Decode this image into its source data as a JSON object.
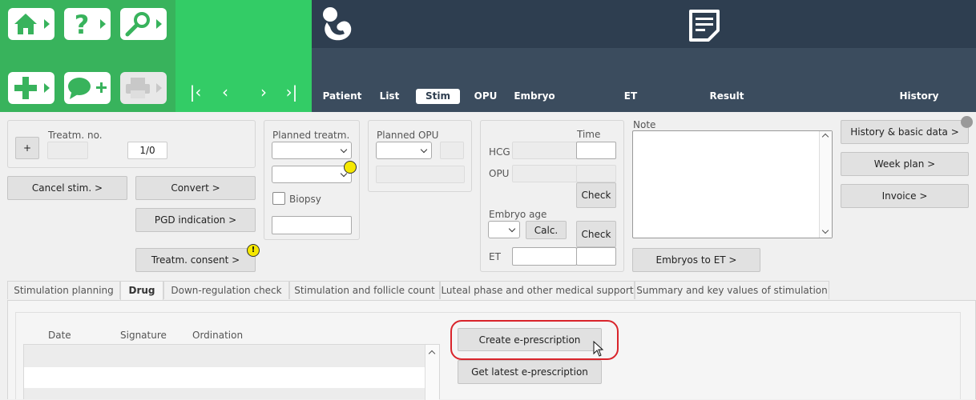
{
  "nav": {
    "home_icon": "home-icon",
    "help_icon": "help-icon",
    "search_icon": "search-icon",
    "add_icon": "plus-icon",
    "chat_icon": "chat-plus-icon",
    "printer_icon": "printer-icon",
    "first": "|‹",
    "prev": "‹",
    "next": "›",
    "last": "›|"
  },
  "tabs": [
    "Patient",
    "List",
    "Stim",
    "OPU",
    "Embryo",
    "ET",
    "Result",
    "History"
  ],
  "active_tab": "Stim",
  "form": {
    "plus_label": "+",
    "treatm_no_label": "Treatm. no.",
    "treatm_no_value": "",
    "treatm_count": "1/0",
    "cancel_stim": "Cancel stim. >",
    "convert": "Convert >",
    "pgd_indication": "PGD indication >",
    "treatm_consent": "Treatm. consent >",
    "warn_mark": "!",
    "planned_treatm_label": "Planned treatm.",
    "biopsy_label": "Biopsy",
    "planned_opu_label": "Planned OPU",
    "time_label": "Time",
    "hcg_label": "HCG",
    "opu_label": "OPU",
    "check1": "Check",
    "embryo_age_label": "Embryo age",
    "calc": "Calc.",
    "check2": "Check",
    "et_label": "ET",
    "note_label": "Note",
    "embryos_to_et": "Embryos to ET >",
    "history_basic": "History & basic data >",
    "week_plan": "Week plan >",
    "invoice": "Invoice >"
  },
  "subtabs": [
    "Stimulation planning",
    "Drug",
    "Down-regulation check",
    "Stimulation and follicle count",
    "Luteal phase and other medical support",
    "Summary and key values of stimulation"
  ],
  "drug": {
    "col_date": "Date",
    "col_signature": "Signature",
    "col_ordination": "Ordination",
    "create_eprescription": "Create e-prescription",
    "get_latest_eprescription": "Get latest e-prescription"
  },
  "colors": {
    "green_dark": "#38b35c",
    "green_light": "#33cc66",
    "navy": "#2e3e50",
    "highlight_red": "#d9242b"
  }
}
